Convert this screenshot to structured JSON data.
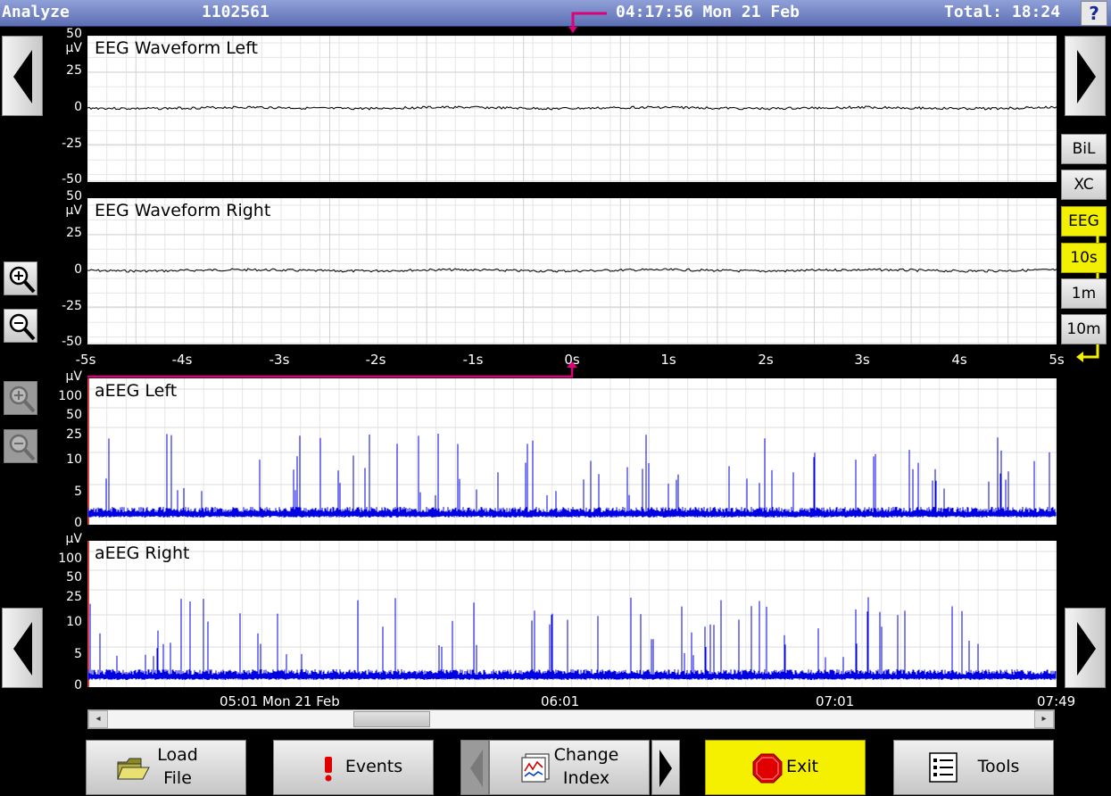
{
  "titlebar": {
    "mode": "Analyze",
    "patient_id": "1102561",
    "timestamp": "04:17:56 Mon 21 Feb",
    "total": "Total: 18:24",
    "help": "?",
    "bar_color": "#5d6fb4",
    "marker_color": "#e0007a"
  },
  "modes": {
    "items": [
      {
        "label": "BiL",
        "active": false
      },
      {
        "label": "XC",
        "active": false
      },
      {
        "label": "EEG",
        "active": true
      },
      {
        "label": "10s",
        "active": true
      },
      {
        "label": "1m",
        "active": false
      },
      {
        "label": "10m",
        "active": false
      }
    ],
    "active_color": "#f2f000"
  },
  "eeg": {
    "unit": "µV",
    "y_ticks": [
      "50",
      "25",
      "0",
      "-25",
      "-50"
    ],
    "x_ticks": [
      "-5s",
      "-4s",
      "-3s",
      "-2s",
      "-1s",
      "0s",
      "1s",
      "2s",
      "3s",
      "4s",
      "5s"
    ],
    "left_title": "EEG Waveform Left",
    "right_title": "EEG Waveform Right"
  },
  "aeeg": {
    "unit": "µV",
    "y_ticks": [
      "100",
      "50",
      "25",
      "10",
      "5",
      "0"
    ],
    "left_title": "aEEG Left",
    "right_title": "aEEG Right",
    "trace_color": "#0000e0",
    "time_labels": [
      "05:01 Mon 21 Feb",
      "06:01",
      "07:01",
      "07:49"
    ]
  },
  "buttons": {
    "load": [
      "Load",
      "File"
    ],
    "events": "Events",
    "change": [
      "Change",
      "Index"
    ],
    "exit": "Exit",
    "tools": "Tools",
    "exit_color": "#f5ef00"
  },
  "scrollbar": {
    "left_arrow": "◂",
    "right_arrow": "▸",
    "position": 0.29
  }
}
